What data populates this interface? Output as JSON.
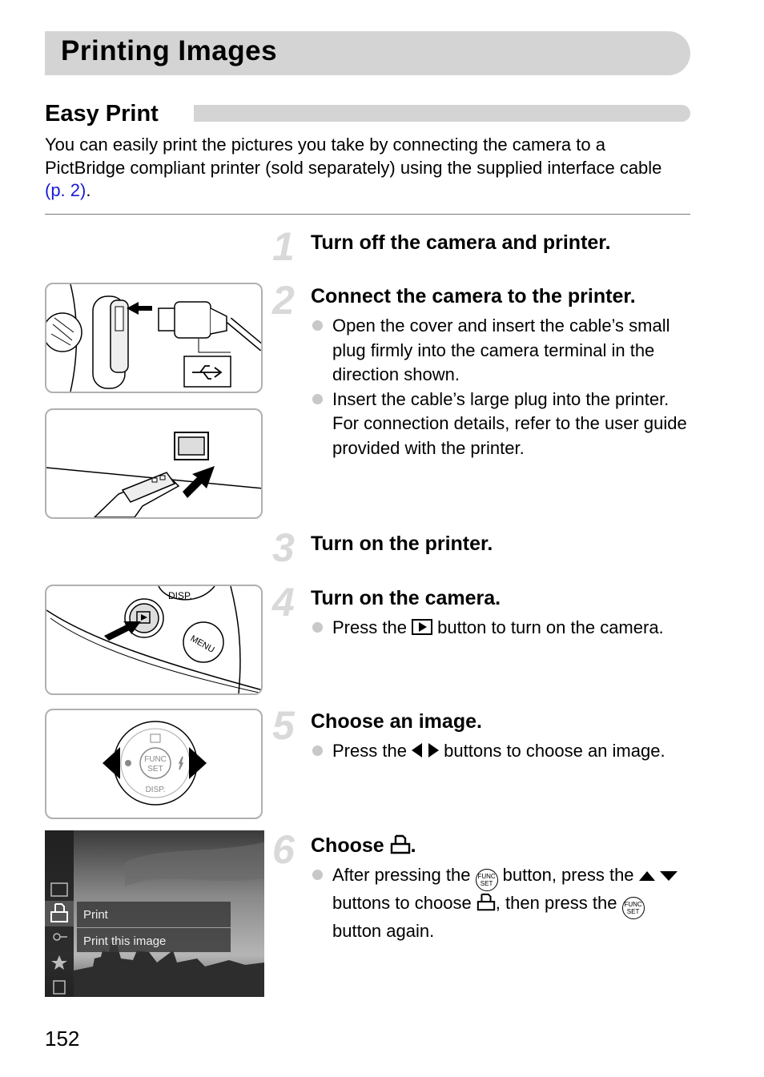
{
  "page": {
    "title": "Printing Images",
    "section_title": "Easy Print",
    "intro": {
      "text": "You can easily print the pictures you take by connecting the camera to a PictBridge compliant printer (sold separately) using the supplied interface cable ",
      "link": "(p. 2)",
      "after_link": "."
    },
    "page_number": "152"
  },
  "steps": [
    {
      "number": "1",
      "title": "Turn off the camera and printer.",
      "bullets": []
    },
    {
      "number": "2",
      "title": "Connect the camera to the printer.",
      "bullets": [
        "Open the cover and insert the cable’s small plug firmly into the camera terminal in the direction shown.",
        "Insert the cable’s large plug into the printer. For connection details, refer to the user guide provided with the printer."
      ]
    },
    {
      "number": "3",
      "title": "Turn on the printer.",
      "bullets": []
    },
    {
      "number": "4",
      "title": "Turn on the camera.",
      "bullets": [
        {
          "before": "Press the ",
          "icon": "playback-button-icon",
          "after": " button to turn on the camera."
        }
      ]
    },
    {
      "number": "5",
      "title": "Choose an image.",
      "bullets": [
        {
          "before": "Press the ",
          "icon": "left-right-arrows-icon",
          "after": " buttons to choose an image."
        }
      ]
    },
    {
      "number": "6",
      "title_before": "Choose ",
      "title_icon": "print-icon",
      "title_after": ".",
      "bullets": [
        {
          "part1": "After pressing the ",
          "icon1": "func-set-button-icon",
          "part2": " button, press the ",
          "icon2": "up-down-arrows-icon",
          "part3": " buttons to choose ",
          "icon3": "print-icon",
          "part4": ", then press the ",
          "icon4": "func-set-button-icon",
          "part5": " button again."
        }
      ]
    }
  ],
  "illustrations": {
    "dial_labels": {
      "func": "FUNC",
      "set": "SET",
      "disp": "DISP."
    },
    "camera_buttons": {
      "disp": "DISP.",
      "menu": "MENU"
    },
    "func_icon": {
      "line1": "FUNC",
      "line2": "SET"
    },
    "screen_menu": {
      "item_title": "Print",
      "item_option": "Print this image"
    }
  }
}
